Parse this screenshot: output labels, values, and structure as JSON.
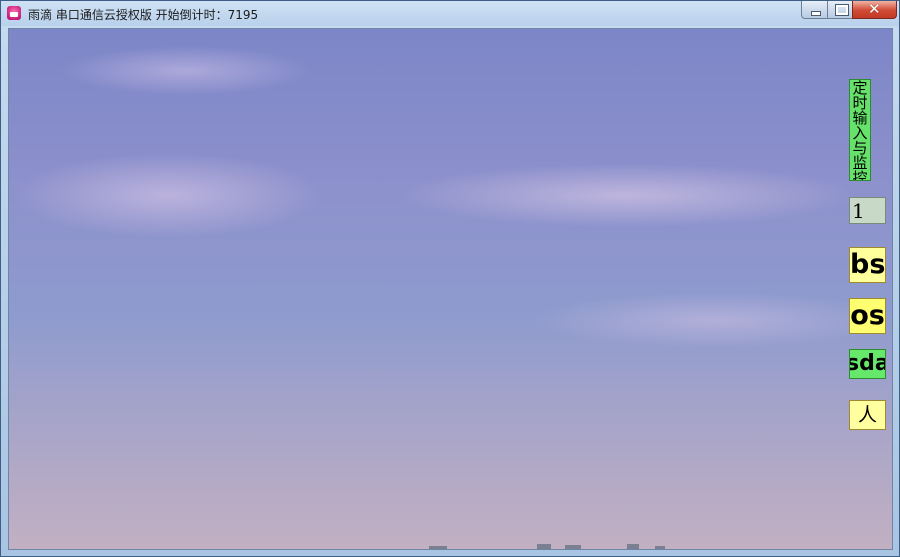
{
  "window": {
    "title": "雨滴 串口通信云授权版    开始倒计时：7195",
    "icon": "app-icon",
    "controls": {
      "minimize": "minimize-icon",
      "maximize": "maximize-icon",
      "close": "close-icon"
    }
  },
  "panel": {
    "timer_label": "定时输入与监控",
    "interval_value": "1",
    "buttons": [
      {
        "label": "bs"
      },
      {
        "label": "os"
      },
      {
        "label": "sda"
      },
      {
        "label": "人"
      }
    ]
  },
  "colors": {
    "green_button": "#66e26a",
    "yellow_button": "#ffff9c",
    "yellow_button_2": "#ffff70",
    "input_bg": "#c8d9c8"
  }
}
